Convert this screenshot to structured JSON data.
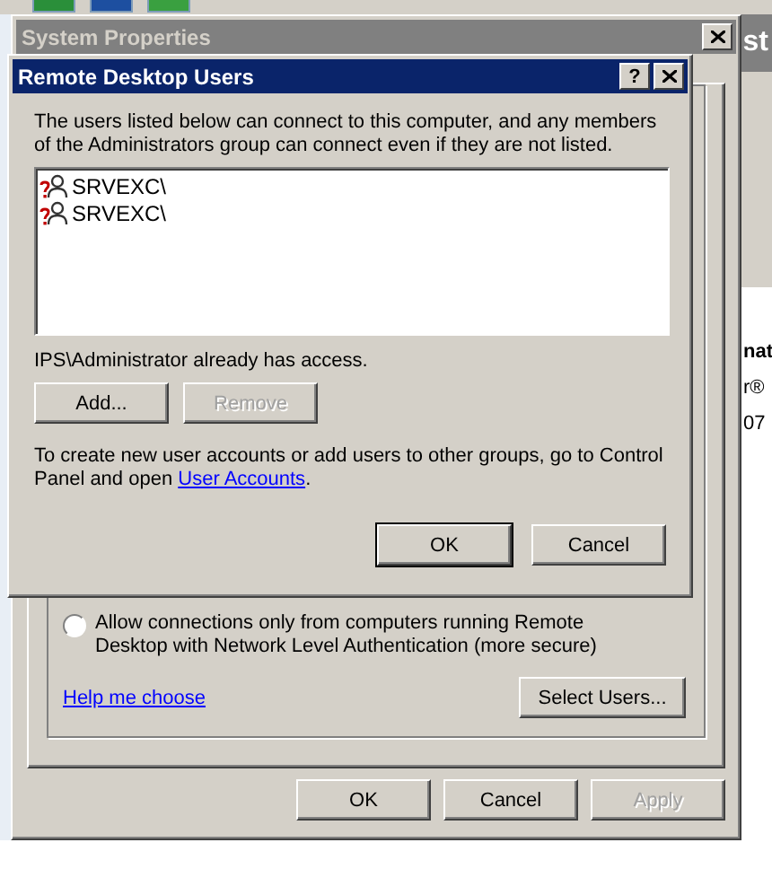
{
  "background_window": {
    "title_fragment": "st",
    "texts": [
      "nat",
      "r®",
      "07"
    ]
  },
  "system_properties": {
    "title": "System Properties",
    "radio": {
      "label": "Allow connections only from computers running Remote Desktop with Network Level Authentication (more secure)",
      "selected": false
    },
    "help_link": "Help me choose",
    "select_users_button": "Select Users...",
    "buttons": [
      {
        "label": "OK",
        "disabled": false
      },
      {
        "label": "Cancel",
        "disabled": false
      },
      {
        "label": "Apply",
        "disabled": true
      }
    ]
  },
  "dialog": {
    "title": "Remote Desktop Users",
    "help_button": "?",
    "intro": "The users listed below can connect to this computer, and any members of the Administrators group can connect even if they are not listed.",
    "users": [
      "SRVEXC\\",
      "SRVEXC\\"
    ],
    "access_note": "IPS\\Administrator already has access.",
    "buttons": [
      {
        "label": "Add...",
        "disabled": false
      },
      {
        "label": "Remove",
        "disabled": true
      }
    ],
    "info_text": "To create new user accounts or add users to other groups, go to Control Panel and open ",
    "info_link": "User Accounts",
    "info_end": ".",
    "footer_buttons": [
      {
        "label": "OK",
        "default": true
      },
      {
        "label": "Cancel",
        "default": false
      }
    ]
  }
}
